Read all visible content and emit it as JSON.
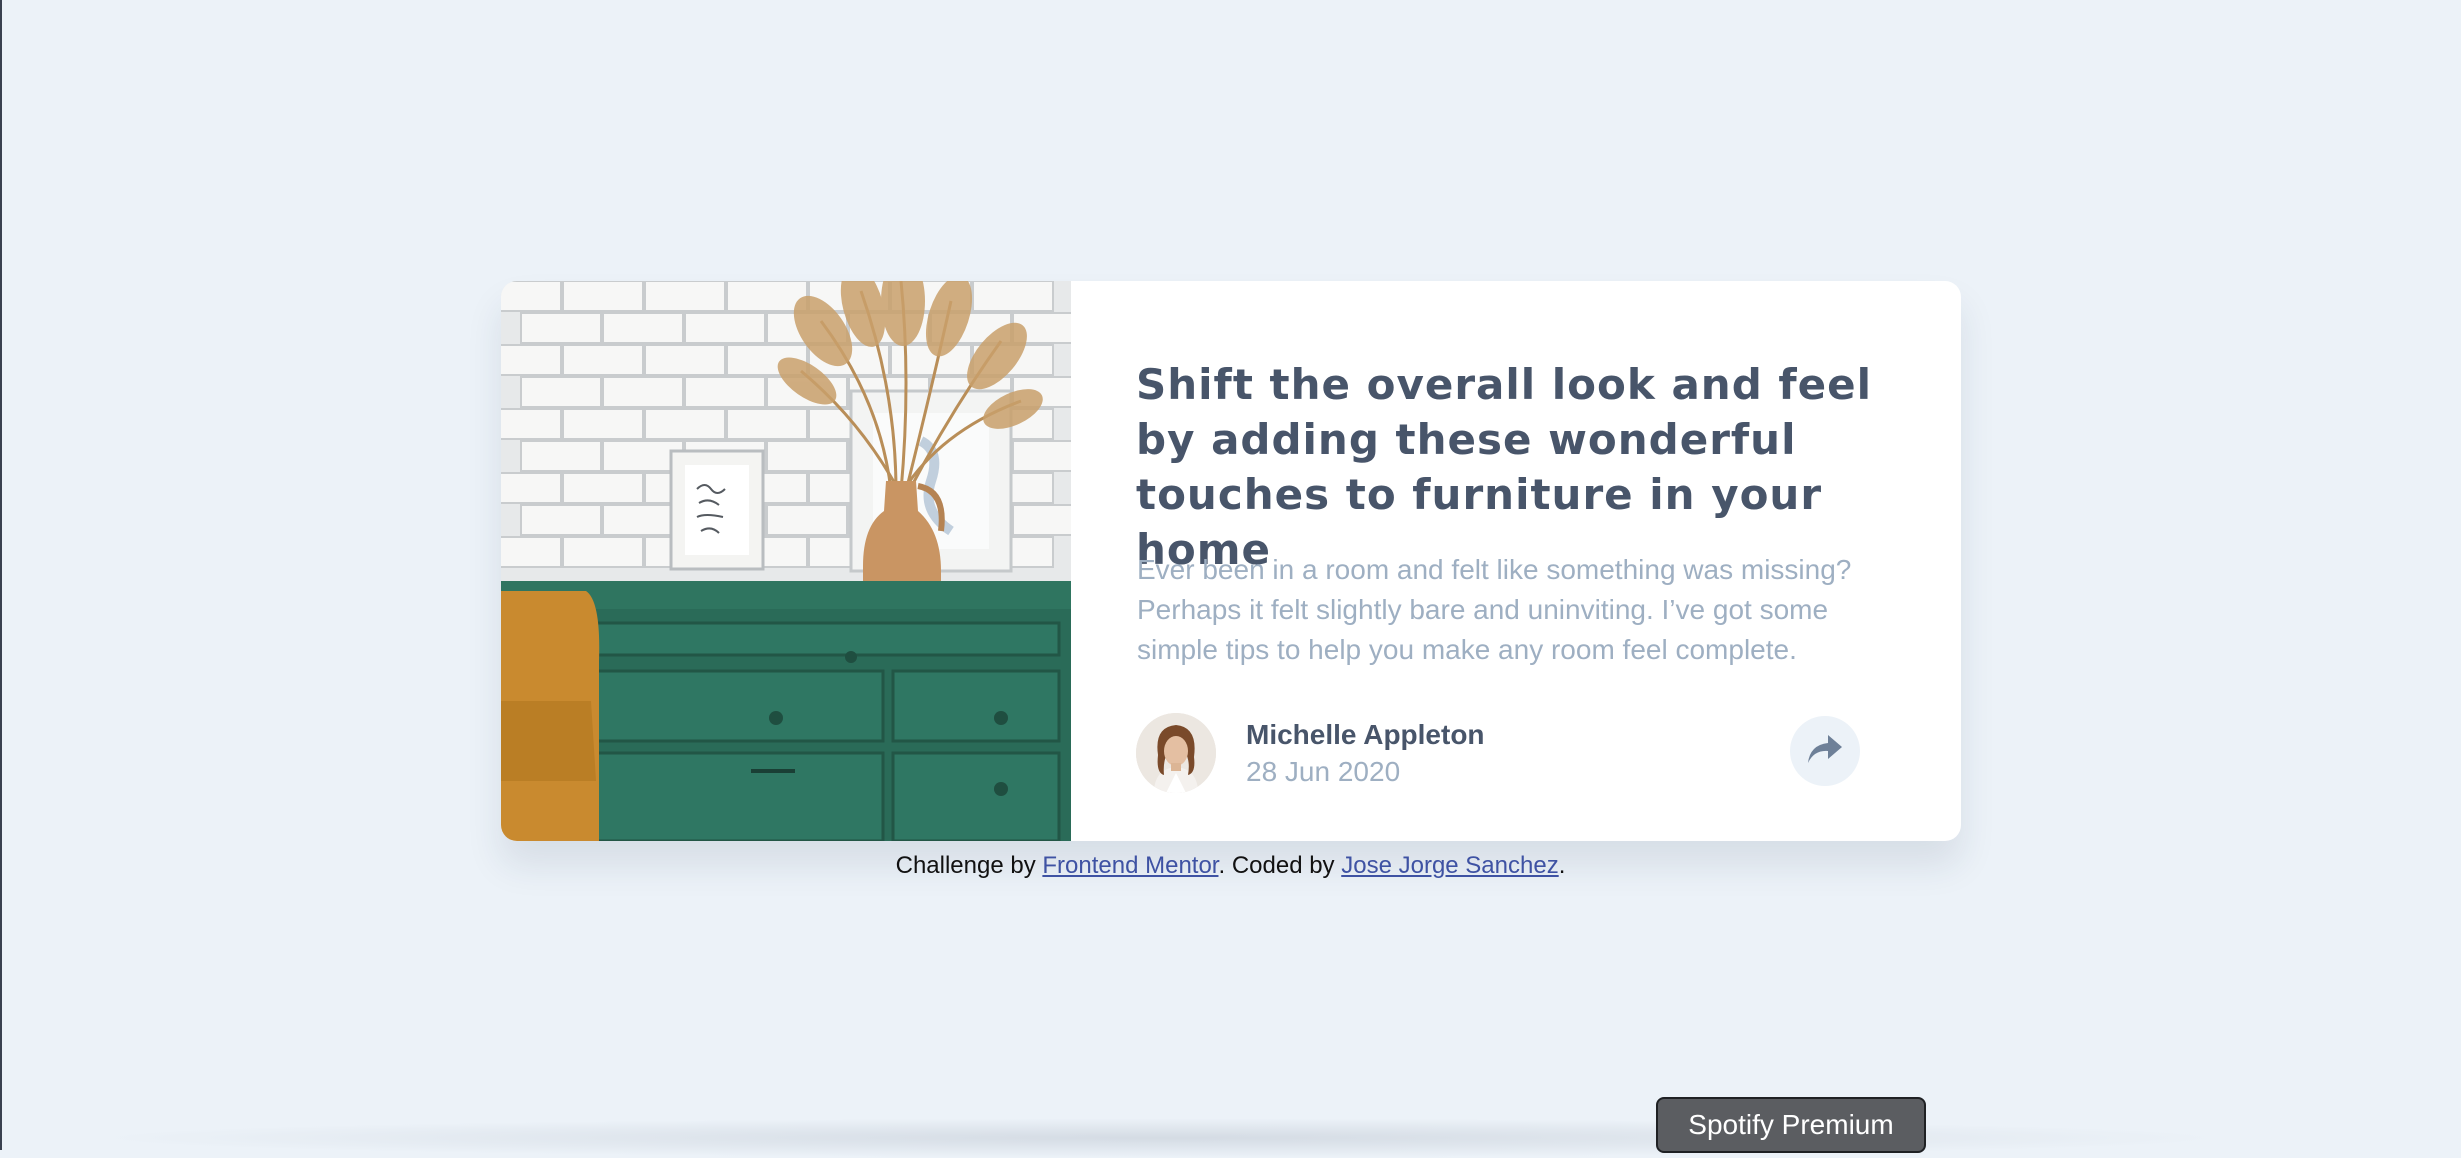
{
  "article": {
    "title": "Shift the overall look and feel by adding these wonderful touches to furniture in your home",
    "description": "Ever been in a room and felt like something was missing? Perhaps it felt slightly bare and uninviting. I’ve got some simple tips to help you make any room feel complete.",
    "photo_alt": "drawers",
    "author": {
      "name": "Michelle Appleton",
      "date": "28 Jun 2020",
      "avatar_alt": "avatar"
    },
    "share_icon": "share-icon"
  },
  "attribution": {
    "prefix": "Challenge by ",
    "link1": "Frontend Mentor",
    "middle": ". Coded by ",
    "link2": "Jose Jorge Sanchez",
    "suffix": "."
  },
  "overlay_button": {
    "label": "Spotify Premium"
  },
  "colors": {
    "background": "#ecf2f8",
    "title": "#48556a",
    "description": "#9eafc2",
    "card": "#ffffff",
    "link": "#3e52a3"
  }
}
